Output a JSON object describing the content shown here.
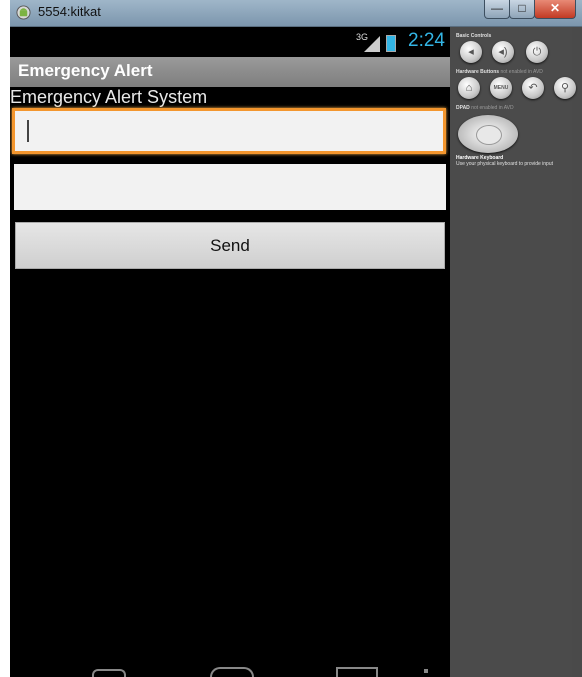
{
  "window": {
    "title": "5554:kitkat",
    "minimize": "—",
    "maximize": "□",
    "close": "✕"
  },
  "status_bar": {
    "network": "3G",
    "time": "2:24"
  },
  "app": {
    "action_bar_title": "Emergency Alert",
    "label": "Emergency Alert System",
    "field1_value": "",
    "field2_value": "",
    "send_label": "Send"
  },
  "controls": {
    "basic_controls": "Basic Controls",
    "hardware_buttons": "Hardware Buttons",
    "hardware_note": "not enabled in AVD",
    "menu_label": "MENU",
    "dpad": "DPAD",
    "dpad_note": "not enabled in AVD",
    "keyboard_title": "Hardware Keyboard",
    "keyboard_text": "Use your physical keyboard to provide input"
  },
  "colors": {
    "accent_blue": "#33b5e5",
    "focus_orange": "#f3962e"
  }
}
